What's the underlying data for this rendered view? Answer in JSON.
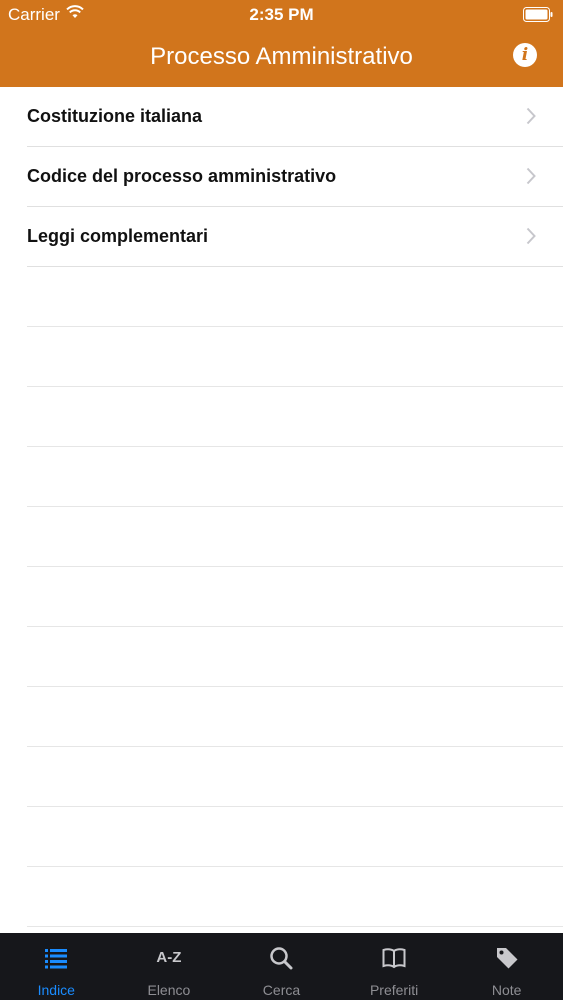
{
  "status_bar": {
    "carrier": "Carrier",
    "time": "2:35 PM"
  },
  "nav": {
    "title": "Processo Amministrativo",
    "info_icon": "info-icon",
    "info_glyph": "i"
  },
  "list": {
    "items": [
      {
        "label": "Costituzione italiana"
      },
      {
        "label": "Codice del processo amministrativo"
      },
      {
        "label": "Leggi complementari"
      }
    ]
  },
  "tabbar": {
    "tabs": [
      {
        "label": "Indice",
        "icon": "list-icon",
        "active": true
      },
      {
        "label": "Elenco",
        "icon": "az-sort-icon",
        "icon_text": "A-Z",
        "active": false
      },
      {
        "label": "Cerca",
        "icon": "search-icon",
        "active": false
      },
      {
        "label": "Preferiti",
        "icon": "book-icon",
        "active": false
      },
      {
        "label": "Note",
        "icon": "tag-icon",
        "active": false
      }
    ]
  },
  "colors": {
    "header": "#d1751c",
    "tabbar": "#16171b",
    "tab_active": "#1a8cff",
    "tab_inactive": "#8e8e93"
  }
}
